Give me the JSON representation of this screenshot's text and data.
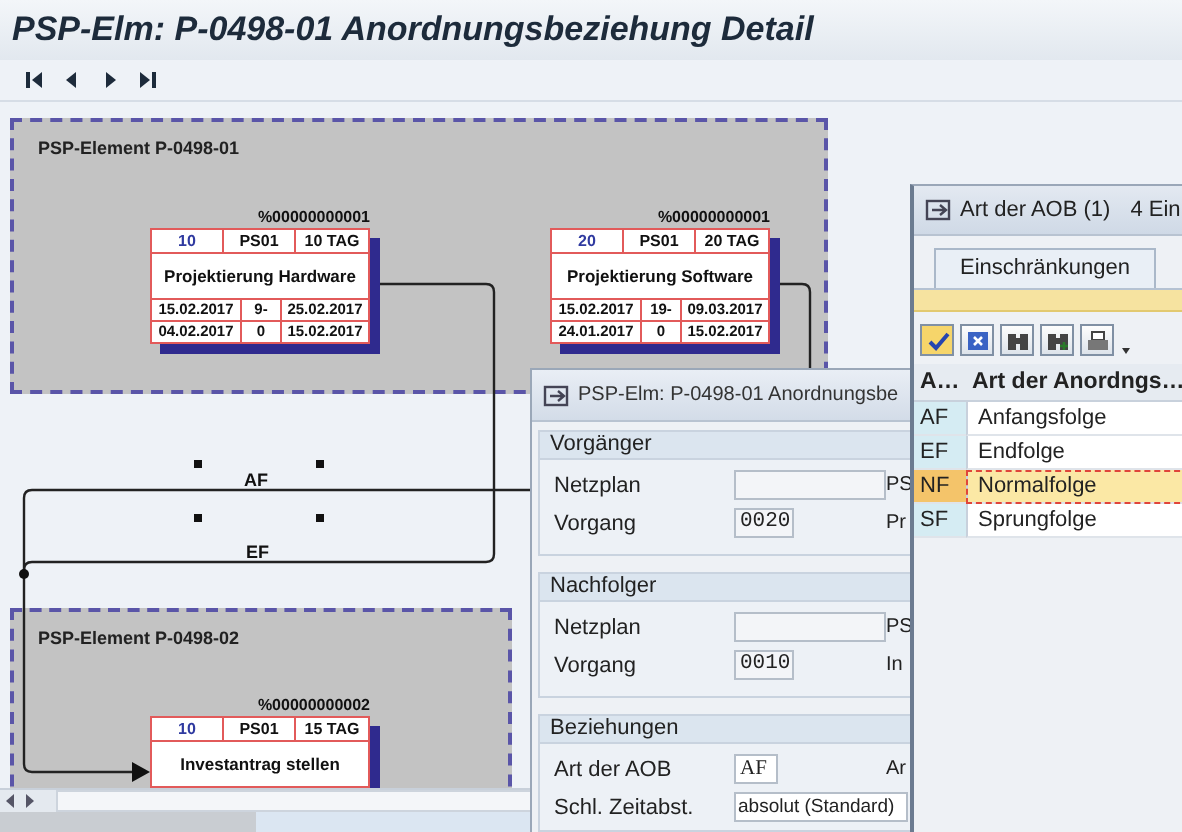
{
  "window": {
    "title": "PSP-Elm: P-0498-01  Anordnungsbeziehung Detail"
  },
  "diagram": {
    "groups": [
      {
        "label": "PSP-Element P-0498-01"
      },
      {
        "label": "PSP-Element P-0498-02"
      }
    ],
    "activities": [
      {
        "code": "%00000000001",
        "number": "10",
        "plant": "PS01",
        "duration": "10 TAG",
        "title": "Projektierung Hardware",
        "dates": [
          [
            "15.02.2017",
            "9-",
            "25.02.2017"
          ],
          [
            "04.02.2017",
            "0",
            "15.02.2017"
          ]
        ]
      },
      {
        "code": "%00000000001",
        "number": "20",
        "plant": "PS01",
        "duration": "20 TAG",
        "title": "Projektierung Software",
        "dates": [
          [
            "15.02.2017",
            "19-",
            "09.03.2017"
          ],
          [
            "24.01.2017",
            "0",
            "15.02.2017"
          ]
        ]
      },
      {
        "code": "%00000000002",
        "number": "10",
        "plant": "PS01",
        "duration": "15 TAG",
        "title": "Investantrag stellen"
      }
    ],
    "links": [
      {
        "label": "AF"
      },
      {
        "label": "EF"
      }
    ]
  },
  "dialog": {
    "title": "PSP-Elm: P-0498-01  Anordnungsbe",
    "sections": [
      {
        "title": "Vorgänger",
        "fields": [
          {
            "label": "Netzplan",
            "side": "PS",
            "kind": "wide"
          },
          {
            "label": "Vorgang",
            "value": "0020",
            "side": "Pr",
            "kind": "short"
          }
        ]
      },
      {
        "title": "Nachfolger",
        "fields": [
          {
            "label": "Netzplan",
            "side": "PS",
            "kind": "wide"
          },
          {
            "label": "Vorgang",
            "value": "0010",
            "side": "In",
            "kind": "short"
          }
        ]
      },
      {
        "title": "Beziehungen",
        "fields": [
          {
            "label": "Art der AOB",
            "value": "AF",
            "side": "Ar",
            "kind": "code"
          },
          {
            "label": "Schl. Zeitabst.",
            "value": "absolut (Standard)",
            "kind": "dropdown"
          }
        ]
      }
    ]
  },
  "picker": {
    "title": "Art der AOB (1)",
    "count": "4 Ein",
    "tab": {
      "label": "Einschränkungen",
      "selected": true
    },
    "columns": [
      "A…",
      "Art der Anordngs…"
    ],
    "rows": [
      {
        "code": "AF",
        "text": "Anfangsfolge",
        "selected": false
      },
      {
        "code": "EF",
        "text": "Endfolge",
        "selected": false
      },
      {
        "code": "NF",
        "text": "Normalfolge",
        "selected": true
      },
      {
        "code": "SF",
        "text": "Sprungfolge",
        "selected": false
      }
    ]
  }
}
